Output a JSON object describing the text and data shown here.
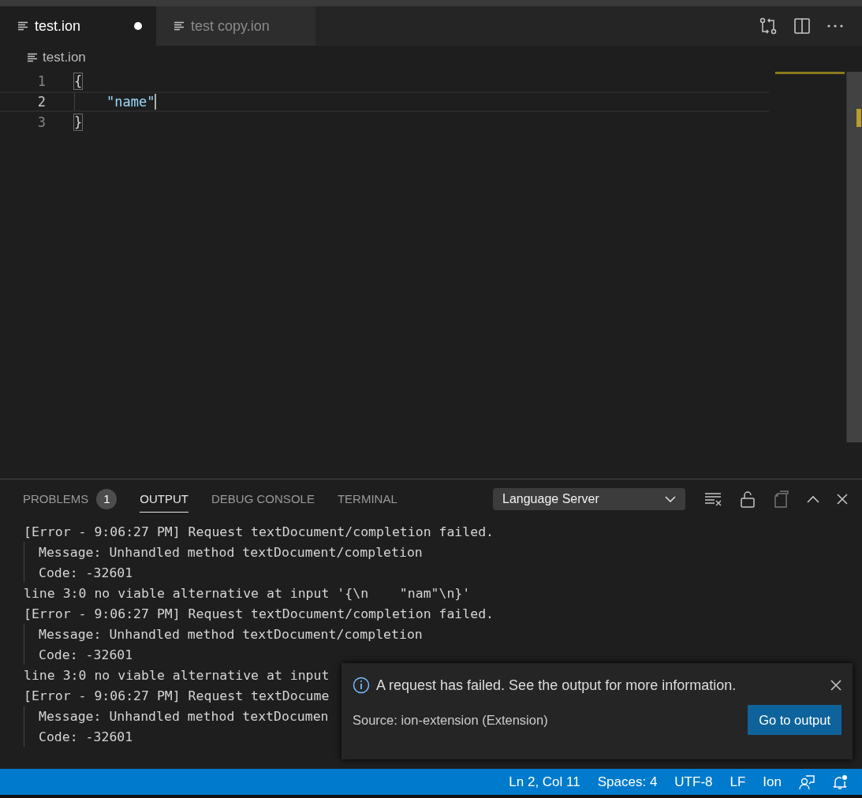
{
  "tabs": [
    {
      "label": "test.ion",
      "selected": true,
      "dirty": true
    },
    {
      "label": "test copy.ion",
      "selected": false,
      "dirty": false
    }
  ],
  "breadcrumb": "test.ion",
  "editor": {
    "lines": [
      {
        "number": "1",
        "indent": false,
        "cursor": false,
        "tokens": [
          {
            "kind": "punct",
            "text": "{"
          }
        ]
      },
      {
        "number": "2",
        "indent": true,
        "cursor": true,
        "tokens": [
          {
            "kind": "string",
            "text": "\"name\""
          }
        ]
      },
      {
        "number": "3",
        "indent": false,
        "cursor": false,
        "tokens": [
          {
            "kind": "punct",
            "text": "}"
          }
        ]
      }
    ]
  },
  "panel": {
    "tabs": [
      {
        "label": "PROBLEMS",
        "badge": "1",
        "selected": false
      },
      {
        "label": "OUTPUT",
        "selected": true
      },
      {
        "label": "DEBUG CONSOLE",
        "selected": false
      },
      {
        "label": "TERMINAL",
        "selected": false
      }
    ],
    "channel": "Language Server",
    "output": [
      {
        "kind": "entry",
        "text": "[Error - 9:06:27 PM] Request textDocument/completion failed."
      },
      {
        "kind": "detail",
        "text": "Message: Unhandled method textDocument/completion"
      },
      {
        "kind": "detail",
        "text": "Code: -32601"
      },
      {
        "kind": "entry",
        "text": "line 3:0 no viable alternative at input '{\\n    \"nam\"\\n}'"
      },
      {
        "kind": "entry",
        "text": "[Error - 9:06:27 PM] Request textDocument/completion failed."
      },
      {
        "kind": "detail",
        "text": "Message: Unhandled method textDocument/completion"
      },
      {
        "kind": "detail",
        "text": "Code: -32601"
      },
      {
        "kind": "entry",
        "text": "line 3:0 no viable alternative at input"
      },
      {
        "kind": "entry",
        "text": "[Error - 9:06:27 PM] Request textDocume"
      },
      {
        "kind": "detail",
        "text": "Message: Unhandled method textDocumen"
      },
      {
        "kind": "detail",
        "text": "Code: -32601"
      }
    ]
  },
  "notification": {
    "message": "A request has failed. See the output for more information.",
    "source": "Source: ion-extension (Extension)",
    "button": "Go to output"
  },
  "status_bar": [
    "Ln 2, Col 11",
    "Spaces: 4",
    "UTF-8",
    "LF",
    "Ion"
  ]
}
